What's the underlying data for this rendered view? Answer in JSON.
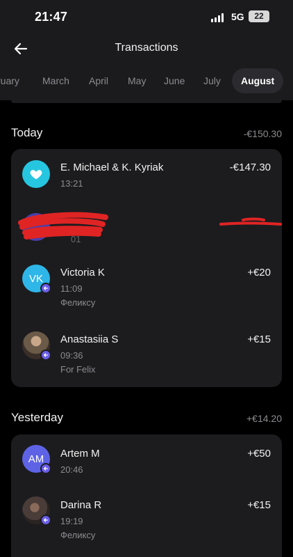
{
  "status": {
    "time": "21:47",
    "network": "5G",
    "battery": "22"
  },
  "header": {
    "title": "Transactions"
  },
  "months": [
    "ruary",
    "March",
    "April",
    "May",
    "June",
    "July",
    "August"
  ],
  "selected_month": "August",
  "sections": [
    {
      "title": "Today",
      "total": "-€150.30",
      "transactions": [
        {
          "name": "E. Michael & K. Kyriak",
          "time": "13:21",
          "amount": "-€147.30",
          "avatar_icon": "heart-icon",
          "avatar_color": "#26c6e0"
        },
        {
          "redacted": true,
          "time_fragment": "01"
        },
        {
          "name": "Victoria K",
          "initials": "VK",
          "time": "11:09",
          "note": "Феликсу",
          "amount": "+€20",
          "avatar_color": "#2fb6e8"
        },
        {
          "name": "Anastasiia S",
          "time": "09:36",
          "note": "For Felix",
          "amount": "+€15",
          "avatar_color": "#6b5a48"
        }
      ]
    },
    {
      "title": "Yesterday",
      "total": "+€14.20",
      "transactions": [
        {
          "name": "Artem M",
          "initials": "AM",
          "time": "20:46",
          "amount": "+€50",
          "avatar_color": "#5e63e6"
        },
        {
          "name": "Darina R",
          "time": "19:19",
          "note": "Феликсу",
          "amount": "+€15",
          "avatar_color": "#4a3c38"
        }
      ]
    }
  ],
  "colors": {
    "background": "#000000",
    "card": "#1c1c1f",
    "accent": "#6a5ee8",
    "muted_text": "#8c8c90",
    "redaction": "#e02424"
  }
}
